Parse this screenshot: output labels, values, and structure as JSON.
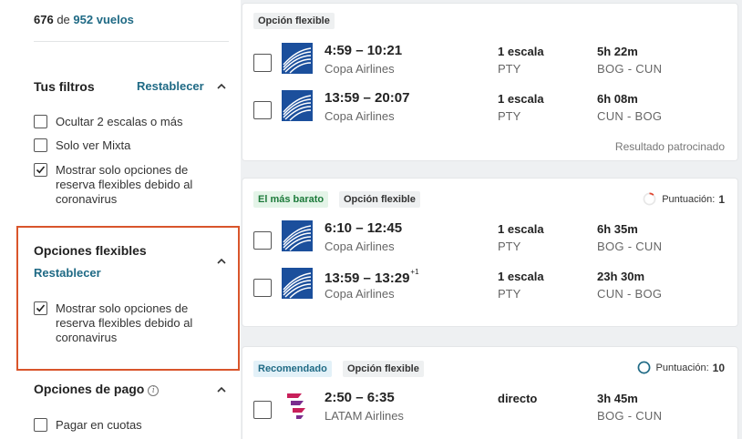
{
  "sidebar": {
    "count": {
      "shown": "676",
      "of": "de",
      "total_link": "952 vuelos"
    },
    "filters": {
      "title": "Tus filtros",
      "reset": "Restablecer",
      "options": [
        {
          "label": "Ocultar 2 escalas o más",
          "checked": false
        },
        {
          "label": "Solo ver Mixta",
          "checked": false
        },
        {
          "label": "Mostrar solo opciones de reserva flexibles debido al coronavirus",
          "checked": true
        }
      ]
    },
    "flexible": {
      "title": "Opciones flexibles",
      "reset": "Restablecer",
      "option": {
        "label": "Mostrar solo opciones de reserva flexibles debido al coronavirus",
        "checked": true
      }
    },
    "payment": {
      "title": "Opciones de pago",
      "info_icon": "i",
      "option": {
        "label": "Pagar en cuotas",
        "checked": false
      }
    }
  },
  "results": [
    {
      "tags": [
        "Opción flexible"
      ],
      "legs": [
        {
          "times": "4:59 – 10:21",
          "plus_day": "",
          "airline": "Copa Airlines",
          "stops": "1 escala",
          "hub": "PTY",
          "duration": "5h 22m",
          "route": "BOG - CUN"
        },
        {
          "times": "13:59 – 20:07",
          "plus_day": "",
          "airline": "Copa Airlines",
          "stops": "1 escala",
          "hub": "PTY",
          "duration": "6h 08m",
          "route": "CUN - BOG"
        }
      ],
      "sponsored": "Resultado patrocinado"
    },
    {
      "tags": [
        "El más barato",
        "Opción flexible"
      ],
      "score_label": "Puntuación:",
      "score_value": "1",
      "legs": [
        {
          "times": "6:10 – 12:45",
          "plus_day": "",
          "airline": "Copa Airlines",
          "stops": "1 escala",
          "hub": "PTY",
          "duration": "6h 35m",
          "route": "BOG - CUN"
        },
        {
          "times": "13:59 – 13:29",
          "plus_day": "+1",
          "airline": "Copa Airlines",
          "stops": "1 escala",
          "hub": "PTY",
          "duration": "23h 30m",
          "route": "CUN - BOG"
        }
      ]
    },
    {
      "tags": [
        "Recomendado",
        "Opción flexible"
      ],
      "score_label": "Puntuación:",
      "score_value": "10",
      "legs": [
        {
          "times": "2:50 – 6:35",
          "plus_day": "",
          "airline": "LATAM Airlines",
          "stops": "directo",
          "hub": "",
          "duration": "3h 45m",
          "route": "BOG - CUN"
        }
      ]
    }
  ],
  "colors": {
    "link": "#1f6a85",
    "highlight": "#d9552b",
    "copa_blue": "#1b4f9c",
    "latam_magenta": "#c8205a"
  }
}
